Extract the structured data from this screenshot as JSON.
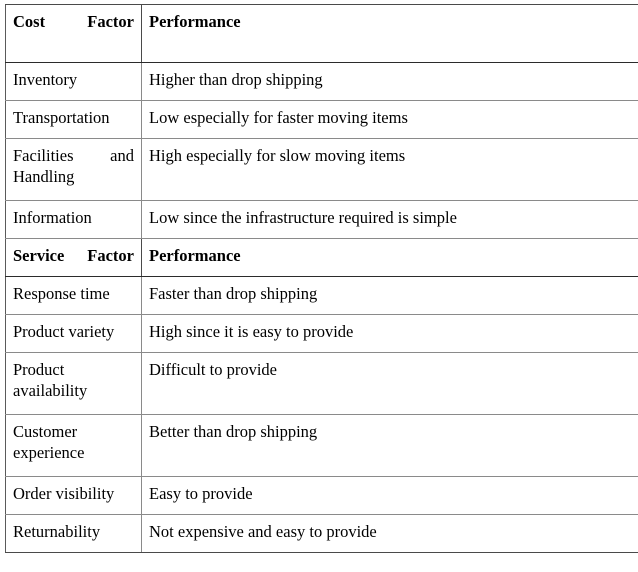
{
  "document": {
    "type": "comparison-table",
    "columns": [
      "Factor",
      "Performance"
    ],
    "text_color": "#000000",
    "background_color": "#ffffff",
    "border_color": "#8a8a8a",
    "header_border_color": "#2b2b2b"
  },
  "table": {
    "sections": [
      {
        "id": "cost",
        "header": {
          "factor": "Cost  Factor",
          "performance": "Performance"
        },
        "rows": [
          {
            "factor": "Inventory",
            "performance": "Higher than drop shipping"
          },
          {
            "factor": "Transportation",
            "performance": "Low especially for faster moving items"
          },
          {
            "factor": "Facilities and Handling",
            "performance": "High especially for slow moving items"
          },
          {
            "factor": "Information",
            "performance": "Low since the infrastructure required is simple"
          }
        ]
      },
      {
        "id": "service",
        "header": {
          "factor": "Service  Factor",
          "performance": "Performance"
        },
        "rows": [
          {
            "factor": "Response time",
            "performance": "Faster than drop shipping"
          },
          {
            "factor": "Product variety",
            "performance": "High since it is easy to provide"
          },
          {
            "factor": "Product availability",
            "performance": "Difficult to provide"
          },
          {
            "factor": "Customer experience",
            "performance": "Better than drop shipping"
          },
          {
            "factor": "Order visibility",
            "performance": "Easy to provide"
          },
          {
            "factor": "Returnability",
            "performance": "Not expensive and easy to provide"
          }
        ]
      }
    ]
  }
}
